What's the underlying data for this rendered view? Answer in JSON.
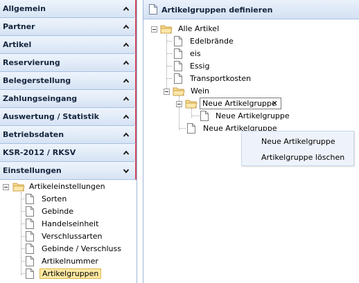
{
  "sidebar": {
    "sections": [
      {
        "label": "Allgemein"
      },
      {
        "label": "Partner"
      },
      {
        "label": "Artikel"
      },
      {
        "label": "Reservierung"
      },
      {
        "label": "Belegerstellung"
      },
      {
        "label": "Zahlungseingang"
      },
      {
        "label": "Auswertung / Statistik"
      },
      {
        "label": "Betriebsdaten"
      },
      {
        "label": "KSR-2012 / RKSV"
      },
      {
        "label": "Einstellungen"
      }
    ],
    "tree": {
      "root": "Artikeleinstellungen",
      "items": [
        "Sorten",
        "Gebinde",
        "Handelseinheit",
        "Verschlussarten",
        "Gebinde / Verschluss",
        "Artikelnummer",
        "Artikelgruppen"
      ]
    }
  },
  "panel": {
    "title": "Artikelgruppen definieren",
    "tree": {
      "root": "Alle Artikel",
      "items": [
        "Edelbrände",
        "eis",
        "Essig",
        "Transportkosten"
      ],
      "wein": "Wein",
      "edit_value": "Neue Artikelgruppe",
      "edit_clear": "✕",
      "child": "Neue Artikelgruppe",
      "sibling": "Neue Artikelgruppe"
    },
    "context_menu": {
      "items": [
        "Neue Artikelgruppe",
        "Artikelgruppe löschen"
      ]
    }
  },
  "colors": {
    "accent": "#d2465a",
    "header_bg": "#d6e3f4",
    "selection": "#fde9a3",
    "folder": "#f4d27a"
  }
}
